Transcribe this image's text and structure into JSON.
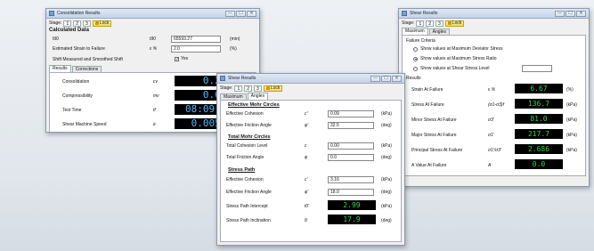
{
  "window_buttons": {
    "minimize": "—",
    "maximize": "☐",
    "close": "✕"
  },
  "stage_buttons": [
    "1",
    "2",
    "3"
  ],
  "lock_label": "Lock",
  "stage_label": "Stage:",
  "consolidation": {
    "title": "Consolidation Results",
    "section_title": "Calculated Data",
    "fields": [
      {
        "label": "t90",
        "symbol": "t90",
        "value": "65593.27",
        "unit": "(min)"
      },
      {
        "label": "Estimated Strain to Failure",
        "symbol": "ε %",
        "value": "2.0",
        "unit": "(%)"
      },
      {
        "label": "Shift Measured and Smoothed Shift",
        "symbol": "",
        "value": "Yes",
        "unit": ""
      }
    ],
    "tabs": [
      "Results",
      "Corrections"
    ],
    "results": [
      {
        "label": "Consolidation",
        "symbol": "cv",
        "value": "0.267"
      },
      {
        "label": "Compressibility",
        "symbol": "mv",
        "value": "0.062"
      },
      {
        "label": "Test Time",
        "symbol": "tf",
        "value": "08:09:32"
      },
      {
        "label": "Shear Machine Speed",
        "symbol": "ė",
        "value": "0.00572"
      }
    ]
  },
  "shear_middle": {
    "title": "Shear Results",
    "tabs": [
      "Maximum",
      "Angles"
    ],
    "section_effective": "Effective Mohr Circles",
    "section_total": "Total Mohr Circles",
    "section_stress": "Stress Path",
    "effective": [
      {
        "label": "Effective Cohesion",
        "symbol": "c'",
        "value": "0.09",
        "unit": "(kPa)"
      },
      {
        "label": "Effective Friction Angle",
        "symbol": "φ'",
        "value": "32.5",
        "unit": "(deg)"
      }
    ],
    "total": [
      {
        "label": "Total Cohesion Level",
        "symbol": "c",
        "value": "0.00",
        "unit": "(kPa)"
      },
      {
        "label": "Total Friction Angle",
        "symbol": "φ",
        "value": "0.0",
        "unit": "(deg)"
      }
    ],
    "stress_path": [
      {
        "label": "Effective Cohesion",
        "symbol": "c'",
        "value": "3.16",
        "unit": "(kPa)"
      },
      {
        "label": "Effective Friction Angle",
        "symbol": "φ'",
        "value": "18.0",
        "unit": "(deg)"
      }
    ],
    "lcd_rows": [
      {
        "label": "Stress Path Intercept",
        "symbol": "t0'",
        "value": "2.99",
        "unit": "(kPa)"
      },
      {
        "label": "Stress Path Inclination",
        "symbol": "θ",
        "value": "17.9",
        "unit": "(deg)"
      }
    ]
  },
  "shear_right": {
    "title": "Shear Results",
    "tabs": [
      "Maximum",
      "Angles"
    ],
    "failure_criteria_label": "Failure Criteria",
    "radios": [
      {
        "label": "Show values at Maximum Deviator Stress",
        "selected": false
      },
      {
        "label": "Show values at Maximum Stress Ratio",
        "selected": true
      },
      {
        "label": "Show values at Shear Stress Level",
        "selected": false
      }
    ],
    "results_label": "Results",
    "results": [
      {
        "label": "Strain At Failure",
        "symbol": "ε %",
        "value": "6.67",
        "unit": "(%)"
      },
      {
        "label": "Stress At Failure",
        "symbol": "(σ1-σ3)f",
        "value": "136.7",
        "unit": "(kPa)"
      },
      {
        "label": "Minor Stress At Failure",
        "symbol": "σ3'",
        "value": "81.0",
        "unit": "(kPa)"
      },
      {
        "label": "Major Stress At Failure",
        "symbol": "σ1'",
        "value": "217.7",
        "unit": "(kPa)"
      },
      {
        "label": "Principal Stress At Failure",
        "symbol": "σ1'/σ3'",
        "value": "2.686",
        "unit": "(kPa)"
      },
      {
        "label": "A Value At Failure",
        "symbol": "A",
        "value": "0.0",
        "unit": ""
      }
    ]
  },
  "colors": {
    "lcd_green": "#39d24b",
    "lcd_blue": "#58b8ff"
  }
}
